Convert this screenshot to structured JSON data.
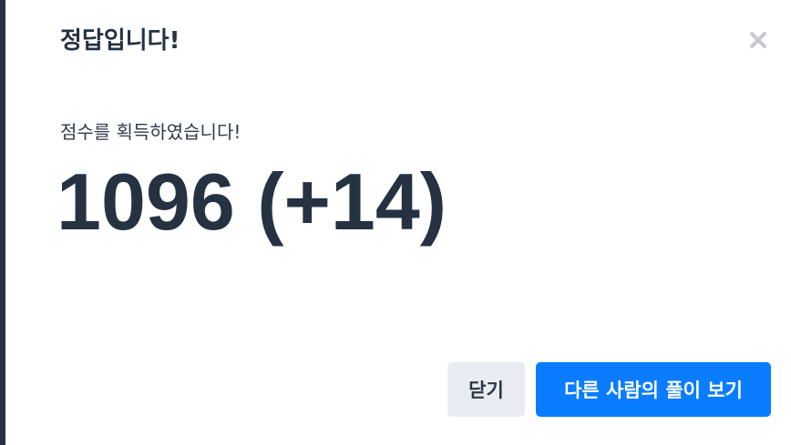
{
  "modal": {
    "title": "정답입니다!",
    "message": "점수를 획득하였습니다!",
    "score": "1096 (+14)",
    "close_button_label": "닫기",
    "primary_button_label": "다른 사람의 풀이 보기"
  },
  "icons": {
    "close": "close-icon"
  },
  "colors": {
    "primary": "#0a7cff",
    "secondary_button_bg": "#e9edf3",
    "text_dark": "#253242",
    "close_icon": "#c4c9d0"
  }
}
